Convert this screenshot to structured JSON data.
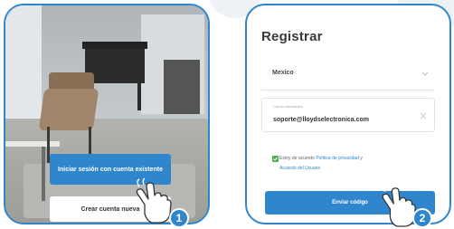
{
  "step1": {
    "login_button": "Iniciar sesión con cuenta existente",
    "create_button": "Crear cuenta nueva",
    "badge": "1"
  },
  "step2": {
    "title": "Registrar",
    "country": "Mexico",
    "email_label": "Correo electrónico",
    "email_value": "soporte@lloydselectronica.com",
    "consent_prefix": "Estoy de acuerdo ",
    "consent_link1": "Política de privacidad",
    "consent_and": " y ",
    "consent_link2": "Acuerdo del Usuario",
    "send_button": "Enviar código",
    "badge": "2"
  },
  "colors": {
    "accent": "#2f86cc",
    "checkbox": "#4caf50"
  }
}
